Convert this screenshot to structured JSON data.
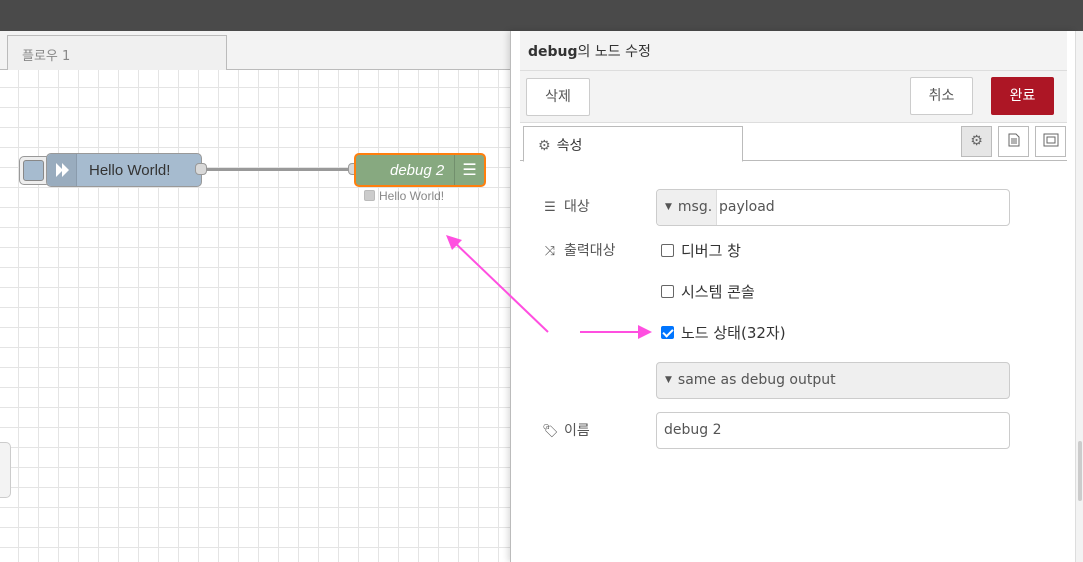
{
  "workspace": {
    "flow_tab": "플로우 1",
    "nodes": {
      "inject_label": "Hello World!",
      "debug_label": "debug 2",
      "debug_status": "Hello World!"
    }
  },
  "panel": {
    "title_bold": "debug",
    "title_rest": "의 노드 수정",
    "buttons": {
      "delete": "삭제",
      "cancel": "취소",
      "done": "완료"
    },
    "tab_properties": "속성",
    "icons": {
      "properties_tab": "gear-icon",
      "description_tab": "document-icon",
      "appearance_tab": "frame-icon",
      "target": "list-icon",
      "output": "shuffle-icon",
      "name": "tag-icon"
    },
    "target": {
      "label": "대상",
      "type": "msg.",
      "value": "payload"
    },
    "output": {
      "label": "출력대상",
      "options": [
        {
          "label": "디버그 창",
          "checked": false
        },
        {
          "label": "시스템 콘솔",
          "checked": false
        },
        {
          "label": "노드 상태(32자)",
          "checked": true
        }
      ],
      "status_select": "same as debug output"
    },
    "name": {
      "label": "이름",
      "value": "debug 2"
    }
  },
  "colors": {
    "done_button": "#ad1625",
    "debug_node": "#87a980",
    "inject_node": "#a6bbcf",
    "selection_border": "#ff7f0e",
    "annotation_arrow": "#ff4fe0"
  }
}
